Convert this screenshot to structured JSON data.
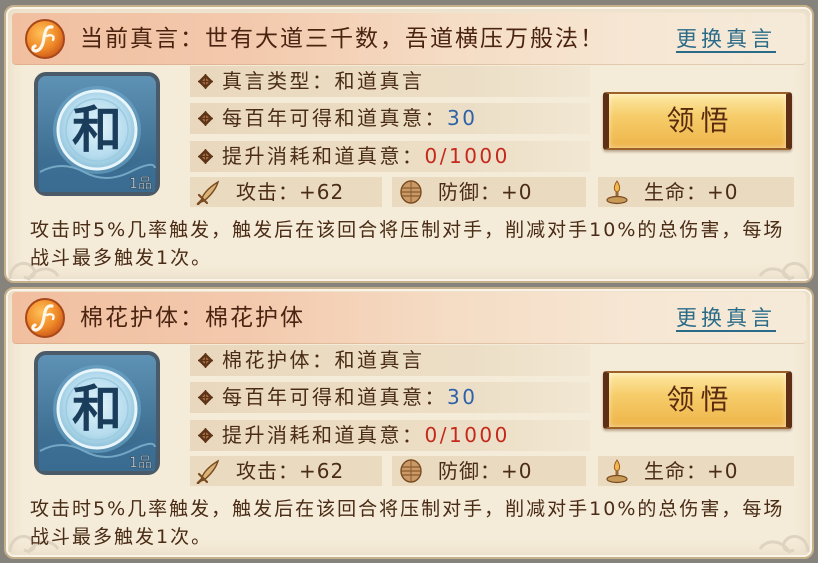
{
  "colors": {
    "title_text": "#4a2410",
    "link": "#2a6b88",
    "body_text": "#4a2c16",
    "button_text": "#5a2a0e",
    "panel_bg": "#f4ebd8"
  },
  "panels": [
    {
      "header_icon": "scroll-badge-icon",
      "title": "当前真言：世有大道三千数，吾道横压万般法！",
      "change_link": "更换真言",
      "emblem": {
        "icon": "he-emblem-icon",
        "char": "和",
        "grade": "1品"
      },
      "rows": [
        {
          "label": "真言类型：",
          "value": "和道真言",
          "value_color": "#4a2c16"
        },
        {
          "label": "每百年可得和道真意：",
          "value": "30",
          "value_color": "#2e62a8"
        },
        {
          "label": "提升消耗和道真意：",
          "value": "0/1000",
          "value_color": "#c4291c"
        }
      ],
      "button": "领悟",
      "stats": [
        {
          "icon": "attack-icon",
          "label": "攻击：",
          "value": "+62"
        },
        {
          "icon": "defense-icon",
          "label": "防御：",
          "value": "+0"
        },
        {
          "icon": "life-icon",
          "label": "生命：",
          "value": "+0"
        }
      ],
      "description_lines": [
        "攻击时5%几率触发，触发后在该回合将压制对手，削减对手10%的总伤害，每场",
        "战斗最多触发1次。"
      ]
    },
    {
      "header_icon": "scroll-badge-icon",
      "title": "棉花护体：棉花护体",
      "change_link": "更换真言",
      "emblem": {
        "icon": "he-emblem-icon",
        "char": "和",
        "grade": "1品"
      },
      "rows": [
        {
          "label": "棉花护体：",
          "value": "和道真言",
          "value_color": "#4a2c16"
        },
        {
          "label": "每百年可得和道真意：",
          "value": "30",
          "value_color": "#2e62a8"
        },
        {
          "label": "提升消耗和道真意：",
          "value": "0/1000",
          "value_color": "#c4291c"
        }
      ],
      "button": "领悟",
      "stats": [
        {
          "icon": "attack-icon",
          "label": "攻击：",
          "value": "+62"
        },
        {
          "icon": "defense-icon",
          "label": "防御：",
          "value": "+0"
        },
        {
          "icon": "life-icon",
          "label": "生命：",
          "value": "+0"
        }
      ],
      "description_lines": [
        "攻击时5%几率触发，触发后在该回合将压制对手，削减对手10%的总伤害，每场",
        "战斗最多触发1次。"
      ]
    }
  ]
}
